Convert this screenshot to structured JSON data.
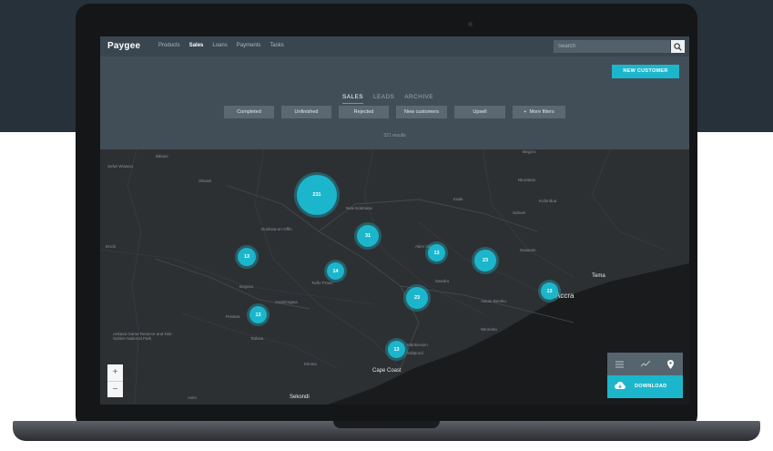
{
  "app": {
    "logo": "Paygee",
    "nav": [
      "Products",
      "Sales",
      "Loans",
      "Payments",
      "Tasks"
    ],
    "active_nav": "Sales",
    "search_placeholder": "Search"
  },
  "panel": {
    "new_customer_label": "NEW CUSTOMER",
    "tabs": [
      "SALES",
      "LEADS",
      "ARCHIVE"
    ],
    "active_tab": "SALES",
    "filters": [
      "Completed",
      "Unfinished",
      "Rejected",
      "New customers",
      "Upsell"
    ],
    "more_filters": "More filters",
    "results": "321 results"
  },
  "map": {
    "clusters": [
      "231",
      "31",
      "13",
      "14",
      "13",
      "23",
      "23",
      "13",
      "13",
      "13"
    ],
    "places": {
      "obuasi": "Obuasi",
      "tema": "Tema",
      "accra": "Accra",
      "cape_coast": "Cape Coast",
      "sekondi": "Sekondi",
      "koforidua": "Koforidua",
      "new_edubiase": "New Edubiase",
      "dunkwa": "Dunkwa-on-Offin",
      "twifo_praso": "Twifo Praso",
      "winneba": "Winneba",
      "asankragwa": "Asankragwa",
      "tarkwa": "Tarkwa",
      "prestea": "Prestea",
      "bogoso": "Bogoso",
      "nkawkaw": "Nkawkaw",
      "akim_oda": "Akim Oda",
      "saltpond": "Saltpond",
      "mankessim": "Mankessim",
      "awutu_bereku": "Awutu Bereku",
      "nsawam": "Nsawam",
      "swedru": "Swedru",
      "bibiani": "Bibiani",
      "sefwi_wiawso": "Sefwi Wiawso",
      "enchi": "Enchi",
      "axim": "Axim",
      "elmina": "Elmina",
      "dunkwa_offin": "Offin",
      "ankasa": "Ankasa Game Reserve and Nini-Suhien National Park",
      "kade": "Kade",
      "suhum": "Suhum",
      "begoro": "Begoro",
      "donkorkrom": "Nkurakan"
    },
    "zoom_in": "+",
    "zoom_out": "−",
    "download_label": "DOWNLOAD"
  },
  "colors": {
    "accent": "#1cb6cc",
    "nav_bg": "#39464f",
    "panel_bg": "#414e58",
    "map_bg": "#2b2d30"
  },
  "icons": [
    "search-icon",
    "plus-icon",
    "list-view-icon",
    "chart-view-icon",
    "map-pin-icon",
    "cloud-download-icon"
  ]
}
